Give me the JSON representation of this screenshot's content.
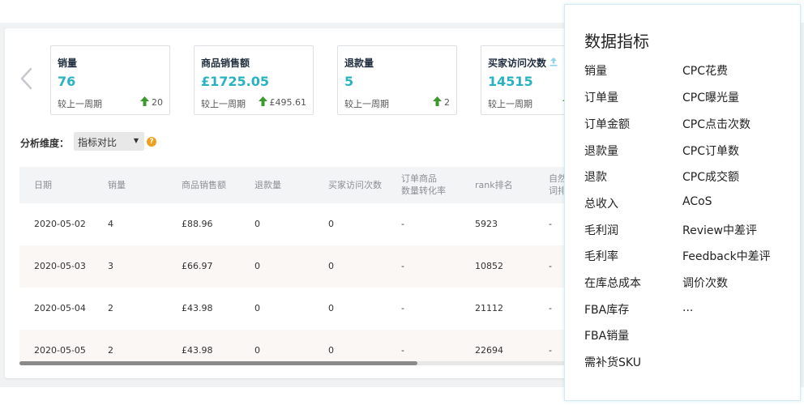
{
  "colors": {
    "accent": "#29b3c2",
    "up_arrow": "#3a9a2c",
    "help_icon": "#f0a020"
  },
  "kpis": [
    {
      "title": "销量",
      "value": "76",
      "compare_label": "较上一周期",
      "delta": "20"
    },
    {
      "title": "商品销售额",
      "value": "£1725.05",
      "compare_label": "较上一周期",
      "delta": "£495.61"
    },
    {
      "title": "退款量",
      "value": "5",
      "compare_label": "较上一周期",
      "delta": "2"
    },
    {
      "title": "买家访问次数",
      "value": "14515",
      "compare_label": "较上一周期",
      "delta": ""
    }
  ],
  "dimension": {
    "label": "分析维度：",
    "selected": "指标对比",
    "help": "?"
  },
  "table": {
    "headers": [
      "日期",
      "销量",
      "商品销售额",
      "退款量",
      "买家访问次数",
      "订单商品",
      "数量转化率",
      "rank排名",
      "自然",
      "词排"
    ],
    "rows": [
      [
        "2020-05-02",
        "4",
        "£88.96",
        "0",
        "0",
        "-",
        "5923",
        "-"
      ],
      [
        "2020-05-03",
        "3",
        "£66.97",
        "0",
        "0",
        "-",
        "10852",
        "-"
      ],
      [
        "2020-05-04",
        "2",
        "£43.98",
        "0",
        "0",
        "-",
        "21112",
        "-"
      ],
      [
        "2020-05-05",
        "2",
        "£43.98",
        "0",
        "0",
        "-",
        "22694",
        "-"
      ]
    ]
  },
  "panel": {
    "title": "数据指标",
    "left": [
      "销量",
      "订单量",
      "订单金额",
      "退款量",
      "退款",
      "总收入",
      "毛利润",
      "毛利率",
      "在库总成本",
      "FBA库存",
      "FBA销量",
      "需补货SKU"
    ],
    "right": [
      "CPC花费",
      "CPC曝光量",
      "CPC点击次数",
      "CPC订单数",
      "CPC成交额",
      "ACoS",
      "Review中差评",
      "Feedback中差评",
      "调价次数",
      "..."
    ]
  }
}
